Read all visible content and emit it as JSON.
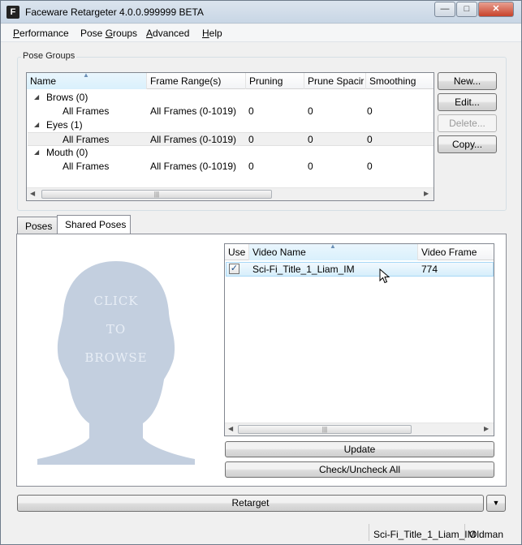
{
  "window": {
    "title": "Faceware Retargeter 4.0.0.999999 BETA",
    "controls": {
      "minimize": "—",
      "maximize": "□",
      "close": "✕"
    }
  },
  "menu": [
    {
      "pre": "P",
      "rest": "erformance"
    },
    {
      "pre": "Pose ",
      "u": "G",
      "rest": "roups"
    },
    {
      "pre": "",
      "u": "A",
      "rest": "dvanced"
    },
    {
      "pre": "",
      "u": "H",
      "rest": "elp"
    }
  ],
  "pose_groups": {
    "label": "Pose Groups",
    "columns": [
      "Name",
      "Frame Range(s)",
      "Pruning",
      "Prune Spacir",
      "Smoothing"
    ],
    "groups": [
      {
        "name": "Brows (0)",
        "child": "All Frames",
        "range": "All Frames (0-1019)",
        "pruning": "0",
        "spacing": "0",
        "smoothing": "0",
        "selected": false
      },
      {
        "name": "Eyes (1)",
        "child": "All Frames",
        "range": "All Frames (0-1019)",
        "pruning": "0",
        "spacing": "0",
        "smoothing": "0",
        "selected": true
      },
      {
        "name": "Mouth (0)",
        "child": "All Frames",
        "range": "All Frames (0-1019)",
        "pruning": "0",
        "spacing": "0",
        "smoothing": "0",
        "selected": false
      }
    ],
    "buttons": {
      "new": "New...",
      "edit": "Edit...",
      "delete": "Delete...",
      "copy": "Copy..."
    }
  },
  "tabs": {
    "poses": "Poses",
    "shared": "Shared Poses"
  },
  "photo": {
    "line1": "CLICK",
    "line2": "TO",
    "line3": "BROWSE"
  },
  "shared_list": {
    "columns": [
      "Use",
      "Video Name",
      "Video Frame"
    ],
    "rows": [
      {
        "checked": true,
        "check_glyph": "✓",
        "name": "Sci-Fi_Title_1_Liam_IM",
        "frame": "774"
      }
    ]
  },
  "buttons": {
    "update": "Update",
    "check_all": "Check/Uncheck All",
    "retarget": "Retarget",
    "retarget_menu": "▼"
  },
  "scroll": {
    "left": "◀",
    "right": "▶",
    "grip": "|||"
  },
  "status": {
    "video": "Sci-Fi_Title_1_Liam_IM",
    "actor": "Oldman"
  },
  "colors": {
    "selection": "#cce8ff",
    "photo_silhouette": "#c3cfdf",
    "photo_text": "#e8eef6"
  }
}
